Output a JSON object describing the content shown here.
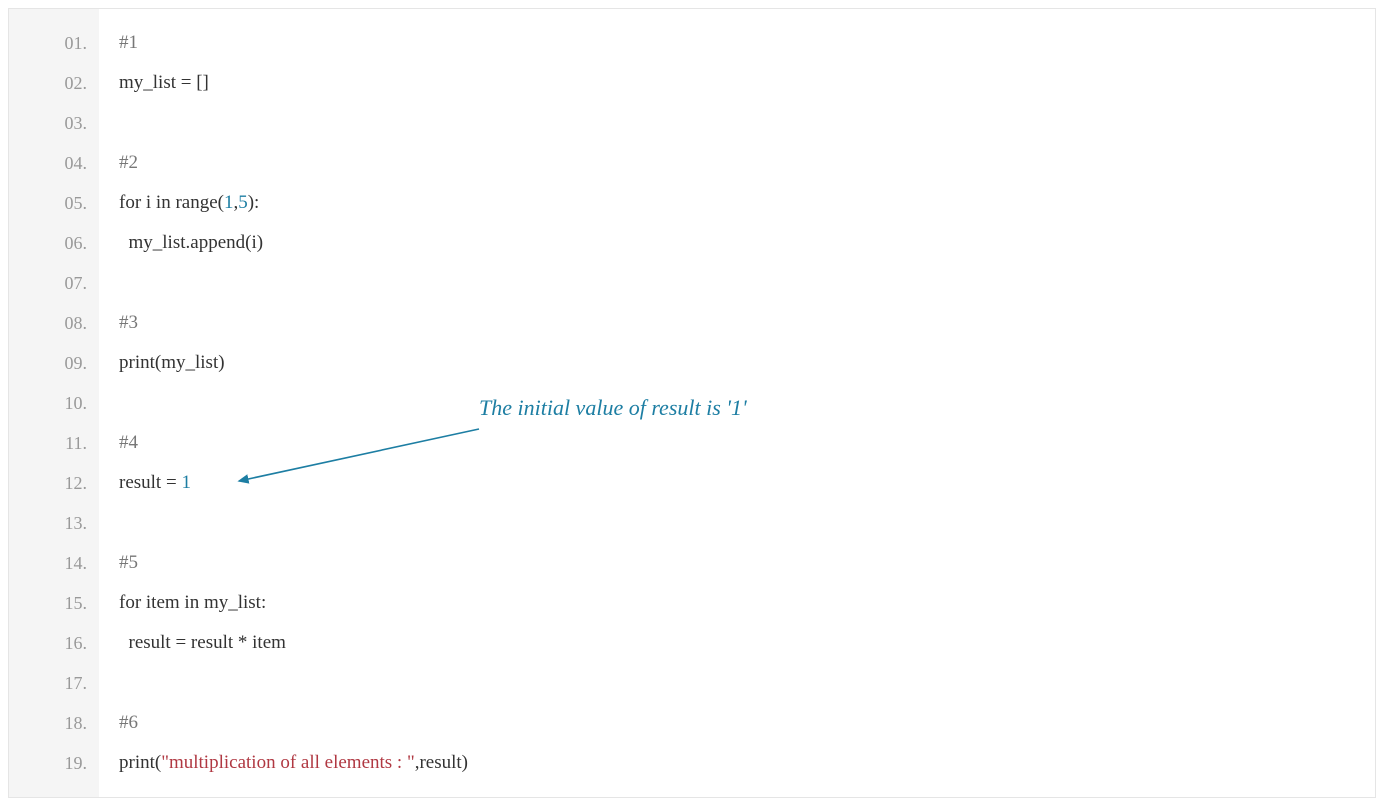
{
  "annotation": {
    "text": "The initial value of result is '1'"
  },
  "colors": {
    "comment": "#777777",
    "number": "#1d7ea3",
    "string": "#b03842",
    "text": "#333333",
    "gutter_bg": "#f5f5f5",
    "gutter_text": "#999999",
    "annotation": "#1d7ea3"
  },
  "lines": [
    {
      "num": "01.",
      "tokens": [
        {
          "t": "#1",
          "c": "comment"
        }
      ]
    },
    {
      "num": "02.",
      "tokens": [
        {
          "t": "my_list = []",
          "c": "ident"
        }
      ]
    },
    {
      "num": "03.",
      "tokens": []
    },
    {
      "num": "04.",
      "tokens": [
        {
          "t": "#2",
          "c": "comment"
        }
      ]
    },
    {
      "num": "05.",
      "tokens": [
        {
          "t": "for i in range(",
          "c": "ident"
        },
        {
          "t": "1",
          "c": "number"
        },
        {
          "t": ",",
          "c": "ident"
        },
        {
          "t": "5",
          "c": "number"
        },
        {
          "t": "):",
          "c": "ident"
        }
      ]
    },
    {
      "num": "06.",
      "tokens": [
        {
          "t": "  my_list.append(i)",
          "c": "ident"
        }
      ]
    },
    {
      "num": "07.",
      "tokens": []
    },
    {
      "num": "08.",
      "tokens": [
        {
          "t": "#3",
          "c": "comment"
        }
      ]
    },
    {
      "num": "09.",
      "tokens": [
        {
          "t": "print(my_list)",
          "c": "ident"
        }
      ]
    },
    {
      "num": "10.",
      "tokens": []
    },
    {
      "num": "11.",
      "tokens": [
        {
          "t": "#4",
          "c": "comment"
        }
      ]
    },
    {
      "num": "12.",
      "tokens": [
        {
          "t": "result = ",
          "c": "ident"
        },
        {
          "t": "1",
          "c": "number"
        }
      ]
    },
    {
      "num": "13.",
      "tokens": []
    },
    {
      "num": "14.",
      "tokens": [
        {
          "t": "#5",
          "c": "comment"
        }
      ]
    },
    {
      "num": "15.",
      "tokens": [
        {
          "t": "for item in my_list:",
          "c": "ident"
        }
      ]
    },
    {
      "num": "16.",
      "tokens": [
        {
          "t": "  result = result * item",
          "c": "ident"
        }
      ]
    },
    {
      "num": "17.",
      "tokens": []
    },
    {
      "num": "18.",
      "tokens": [
        {
          "t": "#6",
          "c": "comment"
        }
      ]
    },
    {
      "num": "19.",
      "tokens": [
        {
          "t": "print(",
          "c": "ident"
        },
        {
          "t": "\"multiplication of all elements : \"",
          "c": "string"
        },
        {
          "t": ",result)",
          "c": "ident"
        }
      ]
    }
  ]
}
